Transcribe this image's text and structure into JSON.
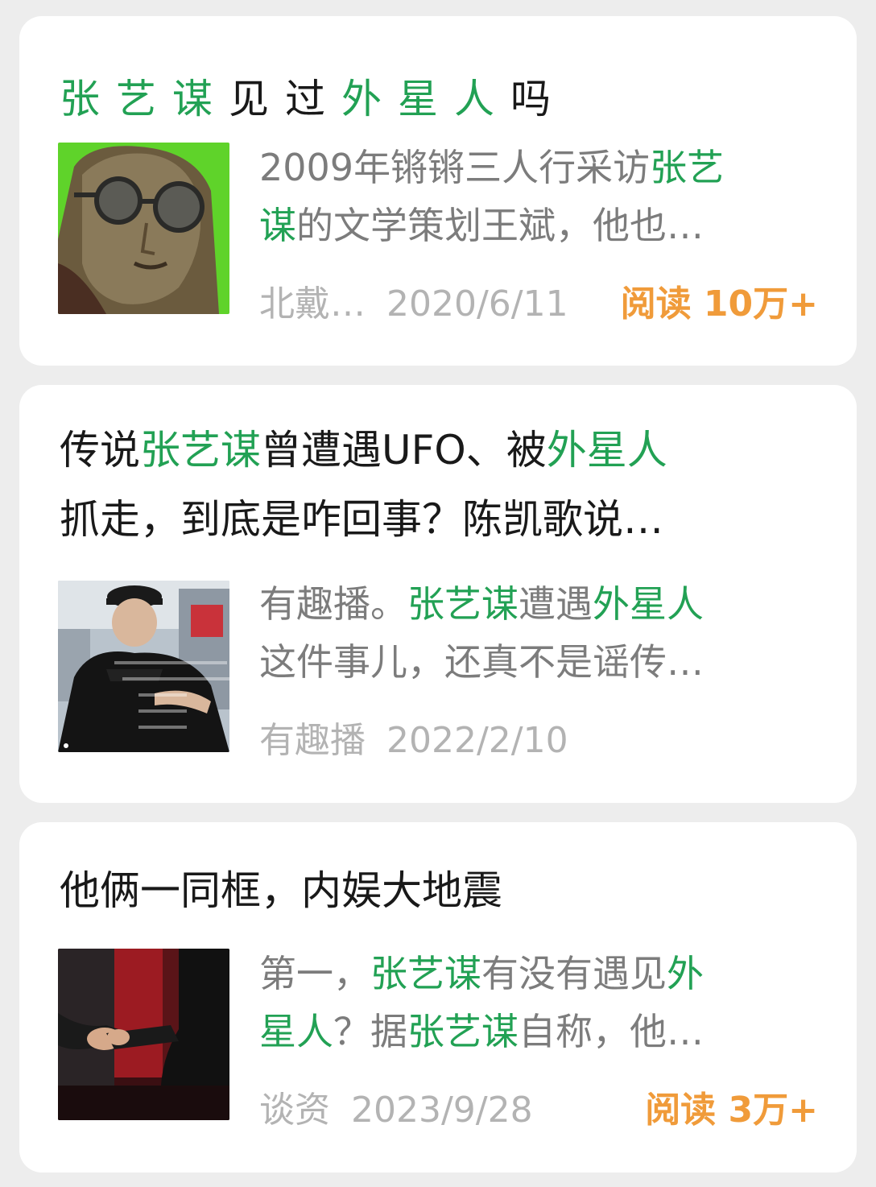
{
  "colors": {
    "highlight": "#22a154",
    "reads": "#f09b3a",
    "meta": "#b3b3b3",
    "snippet": "#7c7c7c"
  },
  "cards": [
    {
      "title": [
        "张",
        "艺",
        "谋",
        "见",
        "过",
        "外",
        "星",
        "人",
        "吗"
      ],
      "snippet_line1": [
        "2009年锵锵三人行采访",
        "张艺"
      ],
      "snippet_line2": [
        "谋",
        "的文学策划王斌，他也…"
      ],
      "source": "北戴…",
      "date": "2020/6/11",
      "reads": "阅读 10万+"
    },
    {
      "title_line1": [
        "传说",
        "张艺谋",
        "曾遭遇UFO、被",
        "外星人"
      ],
      "title_line2": "抓走，到底是咋回事？陈凯歌说…",
      "snippet_line1": [
        "有趣播。",
        "张艺谋",
        "遭遇",
        "外星人"
      ],
      "snippet_line2": "这件事儿，还真不是谣传…",
      "source": "有趣播",
      "date": "2022/2/10"
    },
    {
      "title": "他俩一同框，内娱大地震",
      "snippet_line1": [
        "第一，",
        "张艺谋",
        "有没有遇见",
        "外"
      ],
      "snippet_line2": [
        "星人",
        "？据",
        "张艺谋",
        "自称，他…"
      ],
      "source": "谈资",
      "date": "2023/9/28",
      "reads": "阅读 3万+"
    }
  ]
}
